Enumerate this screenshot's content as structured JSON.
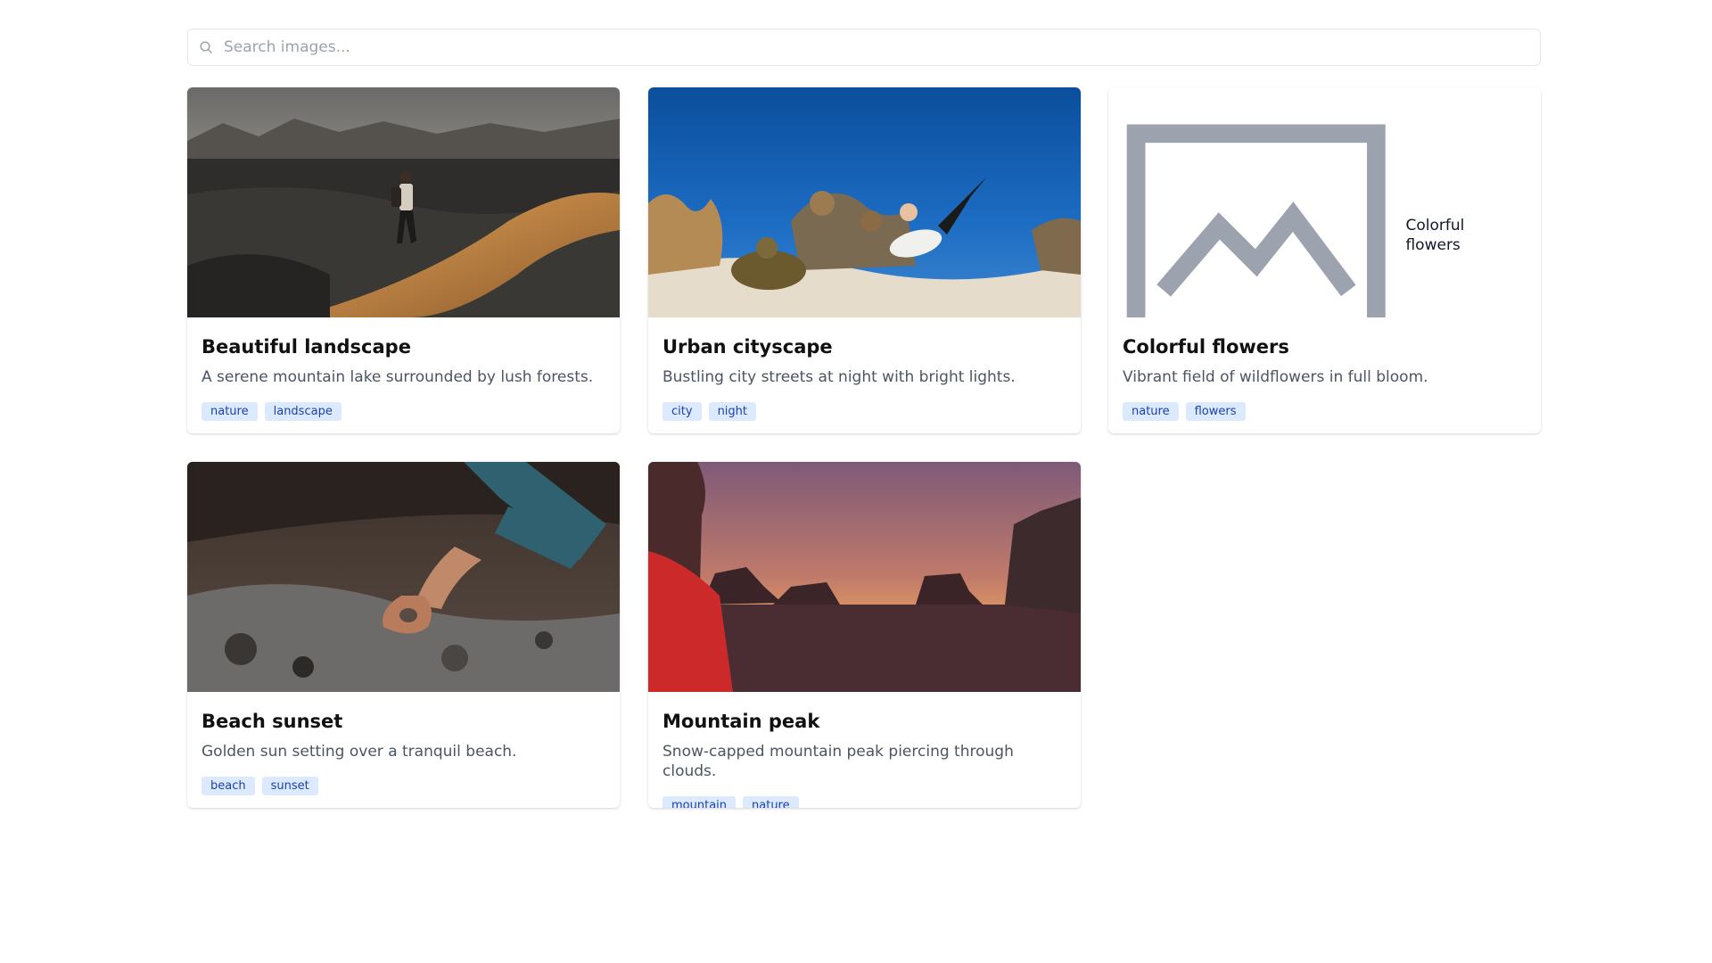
{
  "search": {
    "placeholder": "Search images...",
    "icon": "search-icon"
  },
  "cards": [
    {
      "title": "Beautiful landscape",
      "description": "A serene mountain lake surrounded by lush forests.",
      "tags": [
        "nature",
        "landscape"
      ],
      "image_alt": "Beautiful landscape"
    },
    {
      "title": "Urban cityscape",
      "description": "Bustling city streets at night with bright lights.",
      "tags": [
        "city",
        "night"
      ],
      "image_alt": "Urban cityscape"
    },
    {
      "title": "Colorful flowers",
      "description": "Vibrant field of wildflowers in full bloom.",
      "tags": [
        "nature",
        "flowers"
      ],
      "image_alt": "Colorful flowers"
    },
    {
      "title": "Beach sunset",
      "description": "Golden sun setting over a tranquil beach.",
      "tags": [
        "beach",
        "sunset"
      ],
      "image_alt": "Beach sunset"
    },
    {
      "title": "Mountain peak",
      "description": "Snow-capped mountain peak piercing through clouds.",
      "tags": [
        "mountain",
        "nature"
      ],
      "image_alt": "Mountain peak"
    }
  ],
  "colors": {
    "tag_bg": "#dbeafe",
    "tag_text": "#1e40af",
    "description": "#4b5563",
    "border": "#e5e7eb"
  }
}
